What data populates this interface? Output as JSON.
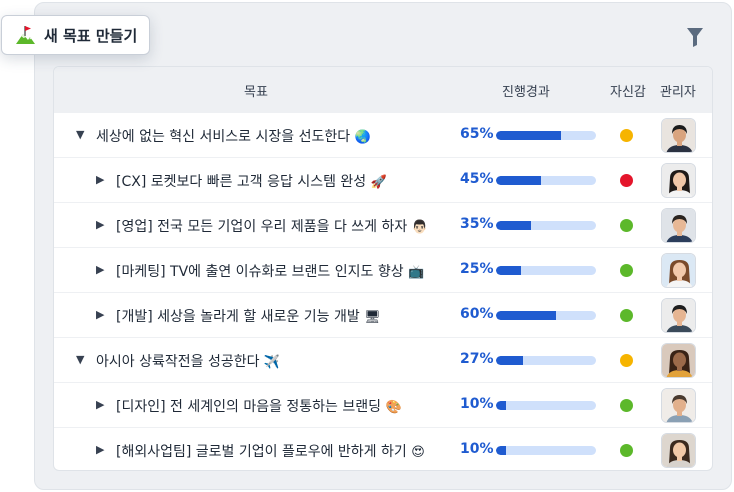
{
  "toolbar": {
    "new_goal_label": "새 목표 만들기",
    "new_goal_icon": "mountain-flag-icon",
    "filter_icon": "filter-icon"
  },
  "table": {
    "headers": {
      "goal": "목표",
      "progress": "진행경과",
      "confidence": "자신감",
      "owner": "관리자"
    },
    "rows": [
      {
        "level": 0,
        "expanded": true,
        "title": "세상에 없는 혁신 서비스로 시장을 선도한다",
        "emoji": "🌏",
        "progress": 65,
        "progress_text": "65%",
        "confidence": "yellow",
        "avatar": "man-dark-hair"
      },
      {
        "level": 1,
        "expanded": false,
        "title": "[CX] 로켓보다 빠른 고객 응답 시스템 완성",
        "emoji": "🚀",
        "progress": 45,
        "progress_text": "45%",
        "confidence": "red",
        "avatar": "woman-long-hair"
      },
      {
        "level": 1,
        "expanded": false,
        "title": "[영업] 전국 모든 기업이 우리 제품을 다 쓰게 하자",
        "emoji": "👨🏻",
        "progress": 35,
        "progress_text": "35%",
        "confidence": "green",
        "avatar": "man-suit"
      },
      {
        "level": 1,
        "expanded": false,
        "title": "[마케팅] TV에 출연 이슈화로 브랜드 인지도 향상",
        "emoji": "📺",
        "progress": 25,
        "progress_text": "25%",
        "confidence": "green",
        "avatar": "woman-brown-hair"
      },
      {
        "level": 1,
        "expanded": false,
        "title": "[개발] 세상을 놀라게 할 새로운 기능 개발",
        "emoji": "🖥",
        "progress": 60,
        "progress_text": "60%",
        "confidence": "green",
        "avatar": "man-short-hair"
      },
      {
        "level": 0,
        "expanded": true,
        "title": "아시아 상륙작전을 성공한다",
        "emoji": "✈️",
        "progress": 27,
        "progress_text": "27%",
        "confidence": "yellow",
        "avatar": "woman-curly-hair"
      },
      {
        "level": 1,
        "expanded": false,
        "title": "[디자인] 전 세계인의 마음을 정통하는 브랜딩",
        "emoji": "🎨",
        "progress": 10,
        "progress_text": "10%",
        "confidence": "green",
        "avatar": "man-beard"
      },
      {
        "level": 1,
        "expanded": false,
        "title": "[해외사업팀] 글로벌 기업이 플로우에 반하게 하기",
        "emoji": "😍",
        "progress": 10,
        "progress_text": "10%",
        "confidence": "green",
        "avatar": "woman-smiling"
      }
    ]
  },
  "colors": {
    "accent": "#1f5bd0",
    "bar_track": "#cfe0fb",
    "yellow": "#f6b400",
    "red": "#e4152b",
    "green": "#5cb82a"
  }
}
